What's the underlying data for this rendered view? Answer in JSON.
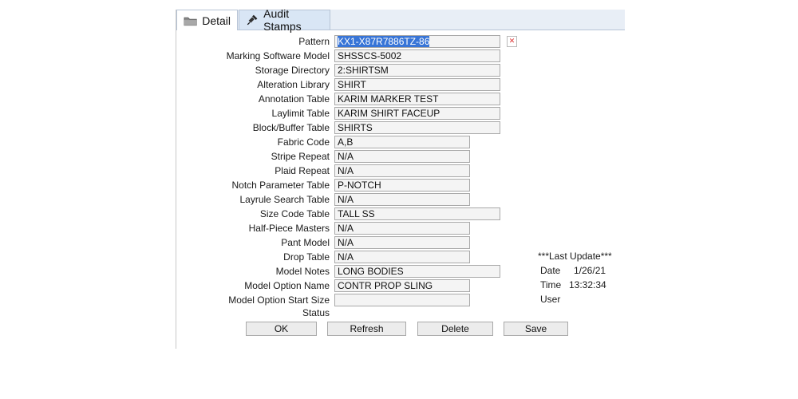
{
  "tabs": {
    "detail": "Detail",
    "audit": "Audit Stamps"
  },
  "pattern": {
    "label": "Pattern",
    "value": "KX1-X87R7886TZ-86"
  },
  "clear_glyph": "✕",
  "fields": {
    "marking_software_model": {
      "label": "Marking Software Model",
      "value": "SHSSCS-5002"
    },
    "storage_directory": {
      "label": "Storage Directory",
      "value": "2:SHIRTSM"
    },
    "alteration_library": {
      "label": "Alteration Library",
      "value": "SHIRT"
    },
    "annotation_table": {
      "label": "Annotation Table",
      "value": "KARIM MARKER TEST"
    },
    "laylimit_table": {
      "label": "Laylimit Table",
      "value": "KARIM SHIRT FACEUP"
    },
    "block_buffer_table": {
      "label": "Block/Buffer Table",
      "value": "SHIRTS"
    },
    "fabric_code": {
      "label": "Fabric Code",
      "value": "A,B"
    },
    "stripe_repeat": {
      "label": "Stripe Repeat",
      "value": "N/A"
    },
    "plaid_repeat": {
      "label": "Plaid Repeat",
      "value": "N/A"
    },
    "notch_parameter_table": {
      "label": "Notch Parameter Table",
      "value": "P-NOTCH"
    },
    "layrule_search_table": {
      "label": "Layrule Search Table",
      "value": "N/A"
    },
    "size_code_table": {
      "label": "Size Code Table",
      "value": "TALL SS"
    },
    "half_piece_masters": {
      "label": "Half-Piece Masters",
      "value": "N/A"
    },
    "pant_model": {
      "label": "Pant Model",
      "value": "N/A"
    },
    "drop_table": {
      "label": "Drop Table",
      "value": "N/A"
    },
    "model_notes": {
      "label": "Model Notes",
      "value": "LONG BODIES"
    },
    "model_option_name": {
      "label": "Model Option Name",
      "value": "CONTR PROP SLING"
    },
    "model_option_start_size": {
      "label": "Model Option Start Size",
      "value": ""
    },
    "status": {
      "label": "Status"
    }
  },
  "last_update": {
    "title": "***Last Update***",
    "date_label": "Date",
    "date_value": "1/26/21",
    "time_label": "Time",
    "time_value": "13:32:34",
    "user_label": "User",
    "user_value": ""
  },
  "buttons": {
    "ok": "OK",
    "refresh": "Refresh",
    "delete": "Delete",
    "save": "Save"
  }
}
